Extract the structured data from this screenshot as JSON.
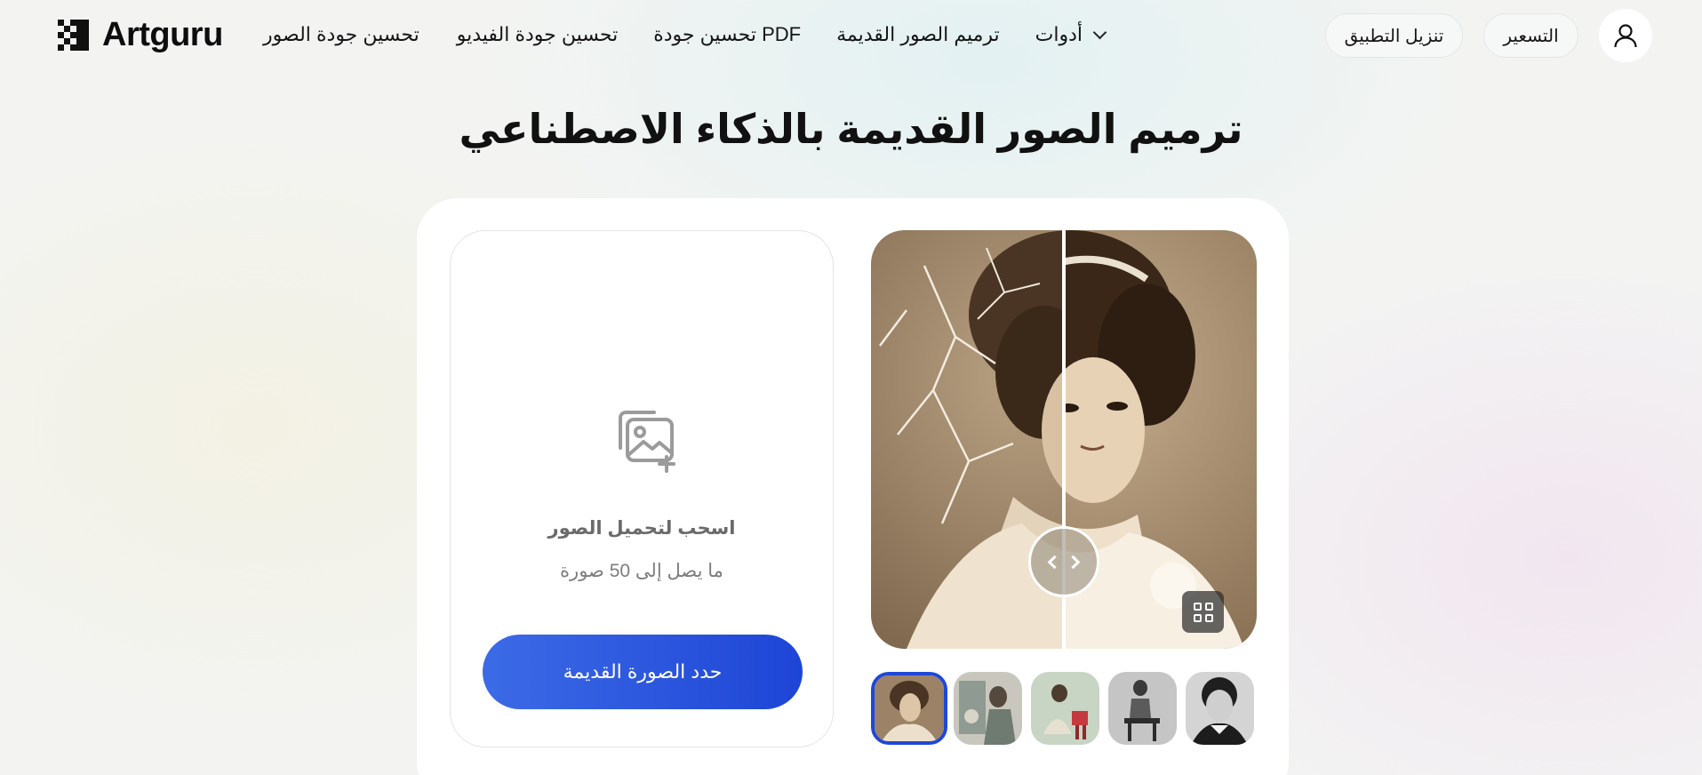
{
  "header": {
    "logo_text": "Artguru",
    "nav": [
      {
        "label": "تحسين جودة الصور"
      },
      {
        "label": "تحسين جودة الفيديو"
      },
      {
        "label": "تحسين جودة PDF"
      },
      {
        "label": "ترميم الصور القديمة"
      },
      {
        "label": "أدوات"
      }
    ],
    "download_app": "تنزيل التطبيق",
    "pricing": "التسعير"
  },
  "page": {
    "title": "ترميم الصور القديمة بالذكاء الاصطناعي"
  },
  "upload": {
    "title": "اسحب لتحميل الصور",
    "subtitle": "ما يصل إلى 50 صورة",
    "button": "حدد الصورة القديمة"
  },
  "viewer": {
    "before_after_position": 0.5
  },
  "thumbnails": {
    "count": 5,
    "selected_index": 0
  },
  "colors": {
    "accent": "#1f48d8",
    "button_gradient_start": "#3c6be6",
    "button_gradient_end": "#1e45d6"
  },
  "icons": {
    "tools_chevron": "chevron-down-icon",
    "account": "user-icon",
    "upload": "image-add-icon",
    "compare": "compare-arrows-icon",
    "gallery": "grid-icon"
  }
}
